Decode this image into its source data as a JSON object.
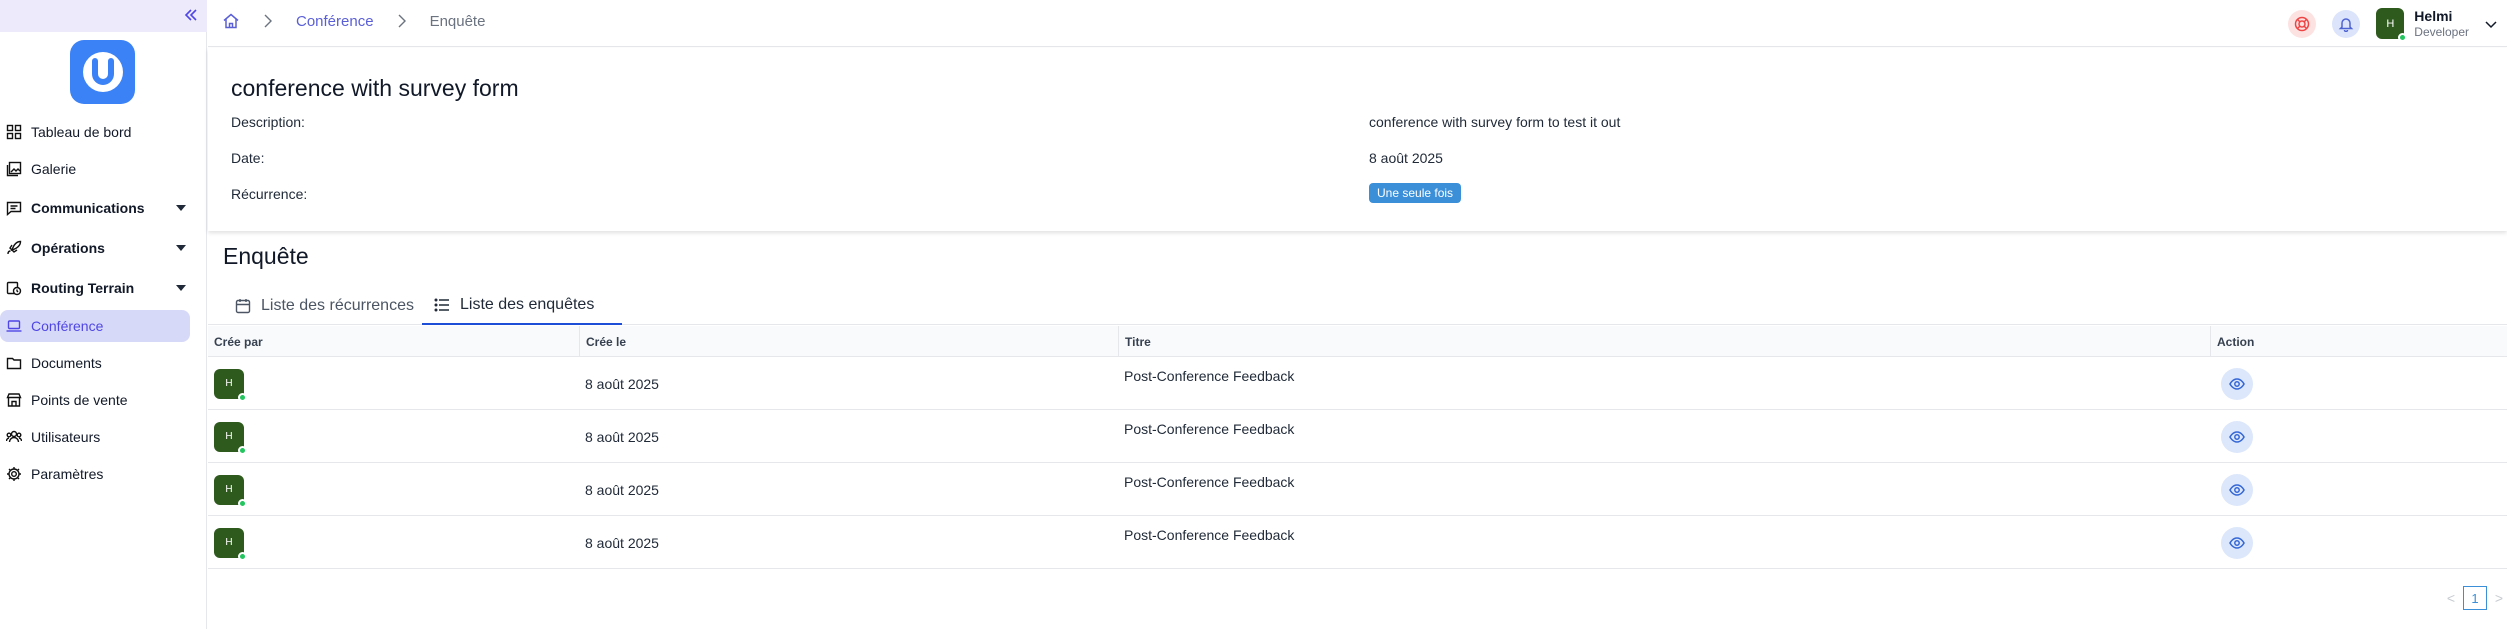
{
  "sidebar": {
    "items": [
      {
        "label": "Tableau de bord",
        "icon": "dashboard-icon"
      },
      {
        "label": "Galerie",
        "icon": "gallery-icon"
      },
      {
        "label": "Communications",
        "icon": "message-icon"
      },
      {
        "label": "Opérations",
        "icon": "rocket-icon"
      },
      {
        "label": "Routing Terrain",
        "icon": "route-icon"
      },
      {
        "label": "Conférence",
        "icon": "laptop-icon"
      },
      {
        "label": "Documents",
        "icon": "folder-icon"
      },
      {
        "label": "Points de vente",
        "icon": "store-icon"
      },
      {
        "label": "Utilisateurs",
        "icon": "users-icon"
      },
      {
        "label": "Paramètres",
        "icon": "gear-icon"
      }
    ]
  },
  "breadcrumb": {
    "parent": "Conférence",
    "current": "Enquête"
  },
  "user": {
    "initial": "H",
    "name": "Helmi",
    "role": "Developer"
  },
  "event": {
    "title": "conference with survey form",
    "description_label": "Description:",
    "description_value": "conference with survey form to test it out",
    "date_label": "Date:",
    "date_value": "8 août 2025",
    "recurrence_label": "Récurrence:",
    "recurrence_value": "Une seule fois"
  },
  "survey": {
    "section_title": "Enquête",
    "tabs": [
      {
        "label": "Liste des récurrences",
        "icon": "calendar-icon"
      },
      {
        "label": "Liste des enquêtes",
        "icon": "list-icon"
      }
    ],
    "columns": [
      "Crée par",
      "Crée le",
      "Titre",
      "Action"
    ],
    "rows": [
      {
        "avatar": "H",
        "created_at": "8 août 2025",
        "title": "Post-Conference Feedback"
      },
      {
        "avatar": "H",
        "created_at": "8 août 2025",
        "title": "Post-Conference Feedback"
      },
      {
        "avatar": "H",
        "created_at": "8 août 2025",
        "title": "Post-Conference Feedback"
      },
      {
        "avatar": "H",
        "created_at": "8 août 2025",
        "title": "Post-Conference Feedback"
      }
    ]
  },
  "pagination": {
    "current_page": "1",
    "prev": "<",
    "next": ">"
  },
  "colors": {
    "accent": "#4f46e5",
    "brand_blue": "#3b82f6",
    "avatar_green": "#2f5a1e",
    "online": "#22c55e",
    "badge": "#3b8fd8"
  }
}
